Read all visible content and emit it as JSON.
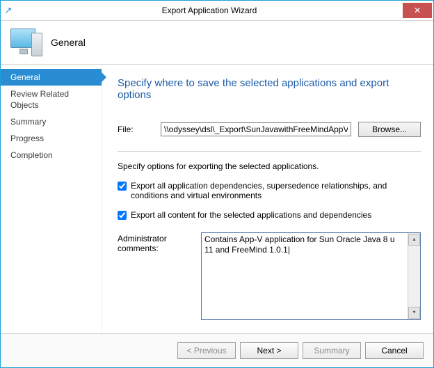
{
  "window": {
    "title": "Export Application Wizard"
  },
  "header": {
    "page_title": "General"
  },
  "sidebar": {
    "items": [
      {
        "label": "General",
        "active": true
      },
      {
        "label": "Review Related Objects",
        "active": false
      },
      {
        "label": "Summary",
        "active": false
      },
      {
        "label": "Progress",
        "active": false
      },
      {
        "label": "Completion",
        "active": false
      }
    ]
  },
  "main": {
    "heading": "Specify where to save the selected applications and export options",
    "file_label": "File:",
    "file_value": "\\\\odyssey\\dsl\\_Export\\SunJavawithFreeMindAppV.zip",
    "browse_label": "Browse...",
    "options_caption": "Specify options for exporting the selected applications.",
    "check_deps_label": "Export all application dependencies, supersedence relationships, and conditions and virtual environments",
    "check_deps_checked": true,
    "check_content_label": "Export all content for the selected applications and dependencies",
    "check_content_checked": true,
    "comments_label": "Administrator comments:",
    "comments_value": "Contains App-V application for Sun Oracle Java 8 u 11 and FreeMind 1.0.1|"
  },
  "footer": {
    "previous": "< Previous",
    "next": "Next >",
    "summary": "Summary",
    "cancel": "Cancel"
  }
}
